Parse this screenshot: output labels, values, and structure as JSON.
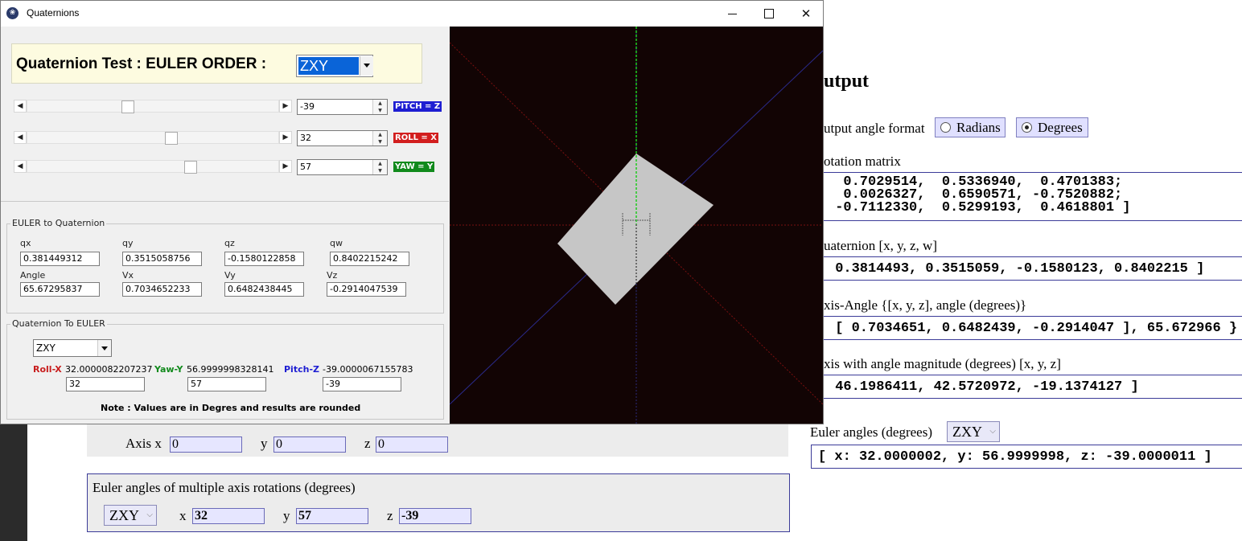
{
  "window": {
    "title": "Quaternions",
    "app_icon": "paw-icon",
    "controls": {
      "minimize": "minimize-icon",
      "maximize": "maximize-icon",
      "close": "close-icon"
    }
  },
  "header": {
    "title": "Quaternion Test : EULER ORDER :",
    "order_value": "ZXY"
  },
  "sliders": [
    {
      "value": "-39",
      "tag": "PITCH = Z",
      "tag_color": "#1e1ed2",
      "position": 0.38
    },
    {
      "value": "32",
      "tag": "ROLL = X",
      "tag_color": "#d21e1e",
      "position": 0.59
    },
    {
      "value": "57",
      "tag": "YAW = Y",
      "tag_color": "#118a1c",
      "position": 0.66
    }
  ],
  "euler_to_quat": {
    "title": "EULER to Quaternion",
    "qx_label": "qx",
    "qx": "0.381449312",
    "qy_label": "qy",
    "qy": "0.3515058756",
    "qz_label": "qz",
    "qz": "-0.1580122858",
    "qw_label": "qw",
    "qw": "0.8402215242",
    "angle_label": "Angle",
    "angle": "65.67295837",
    "vx_label": "Vx",
    "vx": "0.7034652233",
    "vy_label": "Vy",
    "vy": "0.6482438445",
    "vz_label": "Vz",
    "vz": "-0.2914047539"
  },
  "quat_to_euler": {
    "title": "Quaternion To EULER",
    "order": "ZXY",
    "roll_label": "Roll-X",
    "roll_value": "32.0000082207237",
    "roll_input": "32",
    "yaw_label": "Yaw-Y",
    "yaw_value": "56.9999998328141",
    "yaw_input": "57",
    "pitch_label": "Pitch-Z",
    "pitch_value": "-39.0000067155783",
    "pitch_input": "-39",
    "note": "Note : Values are in Degres and results  are rounded"
  },
  "bg": {
    "axis_label": "Axis x",
    "axis_x": "0",
    "y_label": "y",
    "axis_y": "0",
    "z_label": "z",
    "axis_z": "0",
    "multi_title": "Euler angles of multiple axis rotations (degrees)",
    "multi_order": "ZXY",
    "multi_x_label": "x",
    "multi_x": "32",
    "multi_y_label": "y",
    "multi_y": "57",
    "multi_z_label": "z",
    "multi_z": "-39"
  },
  "output": {
    "title": "utput",
    "format_label": "utput angle format",
    "radians": "Radians",
    "degrees": "Degrees",
    "selected_format": "Degrees",
    "rotation_label": "otation matrix",
    "rotation_rows": [
      "  0.7029514,  0.5336940,  0.4701383;",
      "  0.0026327,  0.6590571, -0.7520882;",
      " -0.7112330,  0.5299193,  0.4618801 ]"
    ],
    "quat_label": "uaternion [x, y, z, w]",
    "quat_value": " 0.3814493, 0.3515059, -0.1580123, 0.8402215 ]",
    "axis_angle_label": "xis-Angle {[x, y, z], angle (degrees)}",
    "axis_angle_value": " [ 0.7034651, 0.6482439, -0.2914047 ], 65.672966 }",
    "axis_mag_label": "xis with angle magnitude (degrees) [x, y, z]",
    "axis_mag_value": " 46.1986411, 42.5720972, -19.1374127 ]",
    "euler_label": "Euler angles (degrees)",
    "euler_order": "ZXY",
    "euler_value": "[ x: 32.0000002, y: 56.9999998, z: -39.0000011 ]"
  }
}
